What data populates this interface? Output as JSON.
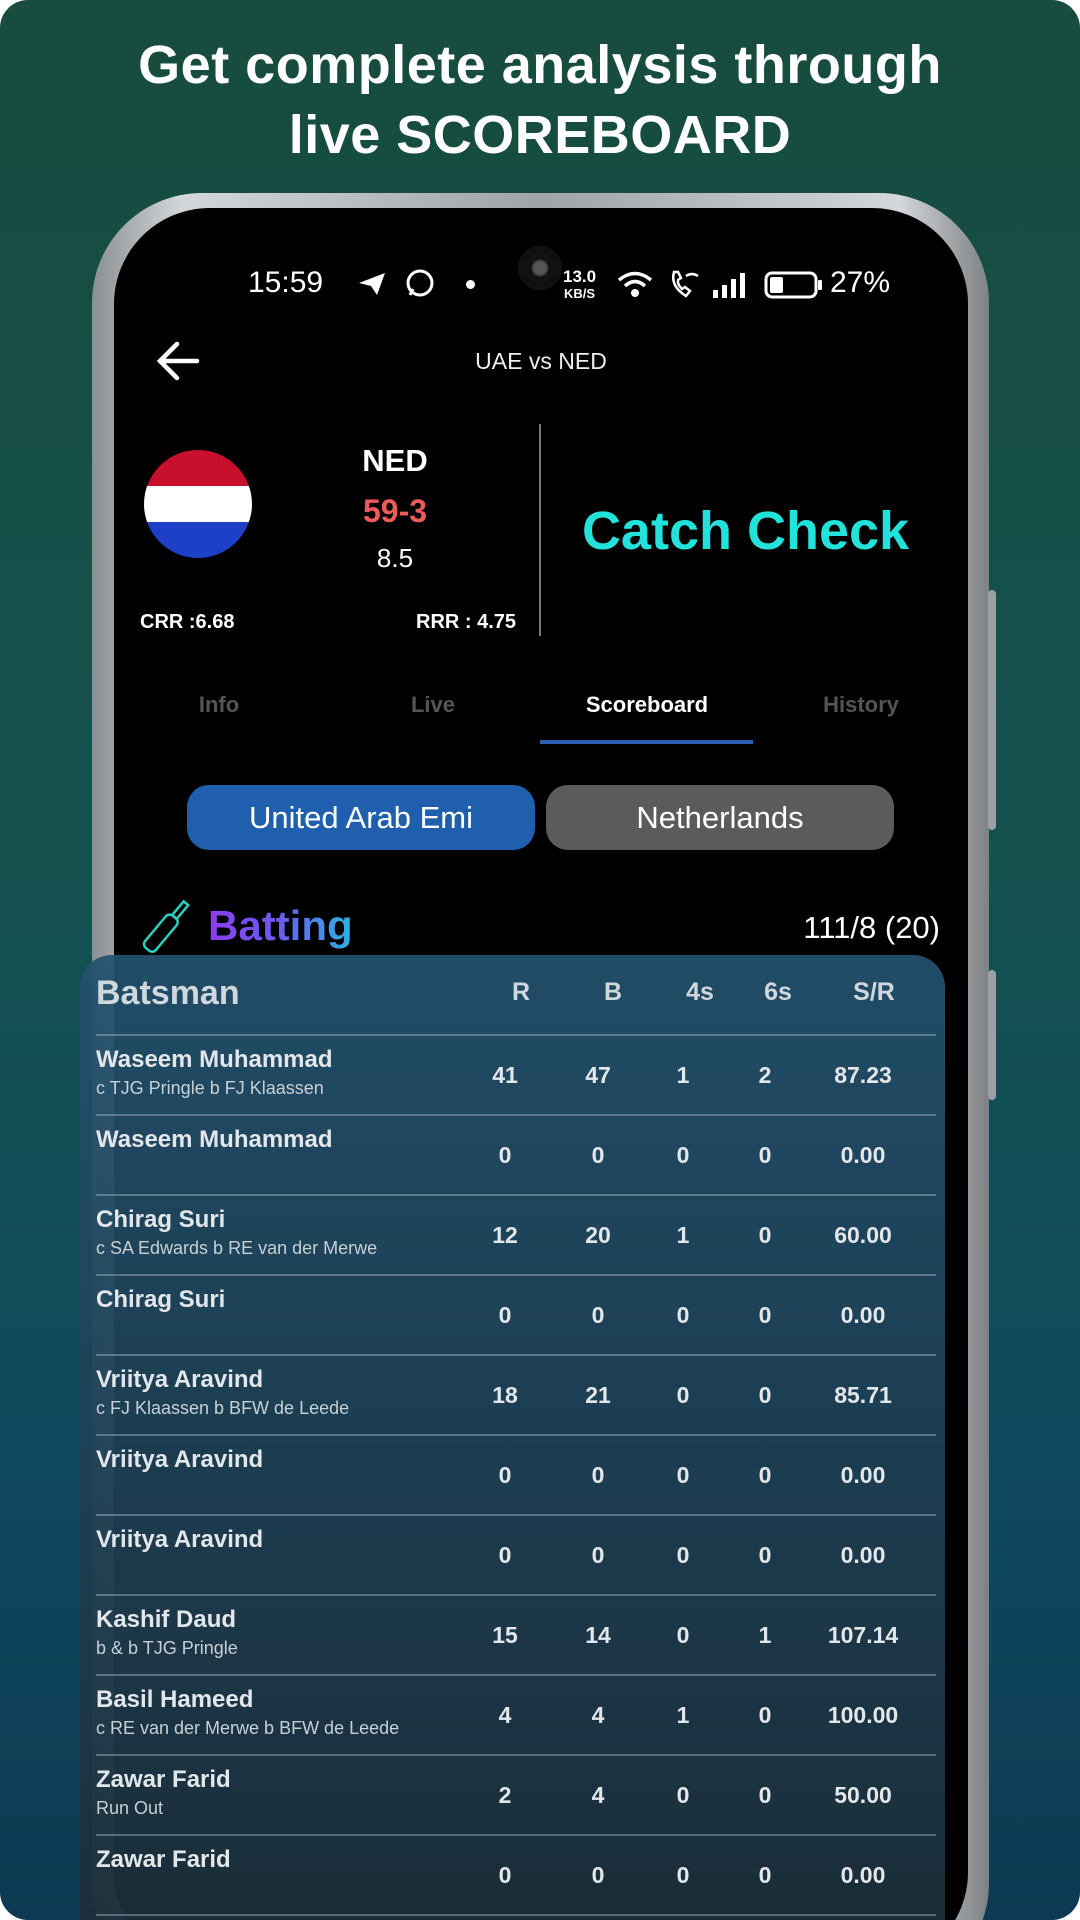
{
  "headline": {
    "line1": "Get complete analysis through",
    "line2": "live SCOREBOARD"
  },
  "status_bar": {
    "time": "15:59",
    "net_speed_value": "13.0",
    "net_speed_unit": "KB/S",
    "battery": "27%"
  },
  "header": {
    "title": "UAE vs NED"
  },
  "match": {
    "team": "NED",
    "score": "59-3",
    "overs": "8.5",
    "crr": "CRR :6.68",
    "rrr": "RRR : 4.75",
    "banner": "Catch Check",
    "flag_colors": [
      "#c8102e",
      "#ffffff",
      "#1e40c8"
    ]
  },
  "tabs": [
    {
      "label": "Info"
    },
    {
      "label": "Live"
    },
    {
      "label": "Scoreboard",
      "active": true
    },
    {
      "label": "History"
    }
  ],
  "teams": [
    {
      "label": "United Arab Emi",
      "selected": true
    },
    {
      "label": "Netherlands"
    }
  ],
  "batting": {
    "title": "Batting",
    "total": "111/8 (20)"
  },
  "table": {
    "headers": [
      "Batsman",
      "R",
      "B",
      "4s",
      "6s",
      "S/R"
    ],
    "rows": [
      {
        "name": "Waseem Muhammad",
        "dismissal": "c TJG Pringle b FJ Klaassen",
        "r": "41",
        "b": "47",
        "fours": "1",
        "sixes": "2",
        "sr": "87.23"
      },
      {
        "name": "Waseem Muhammad",
        "dismissal": "",
        "r": "0",
        "b": "0",
        "fours": "0",
        "sixes": "0",
        "sr": "0.00"
      },
      {
        "name": "Chirag Suri",
        "dismissal": "c SA Edwards b RE van der Merwe",
        "r": "12",
        "b": "20",
        "fours": "1",
        "sixes": "0",
        "sr": "60.00"
      },
      {
        "name": "Chirag Suri",
        "dismissal": "",
        "r": "0",
        "b": "0",
        "fours": "0",
        "sixes": "0",
        "sr": "0.00"
      },
      {
        "name": "Vriitya Aravind",
        "dismissal": "c FJ Klaassen b BFW de Leede",
        "r": "18",
        "b": "21",
        "fours": "0",
        "sixes": "0",
        "sr": "85.71"
      },
      {
        "name": "Vriitya Aravind",
        "dismissal": "",
        "r": "0",
        "b": "0",
        "fours": "0",
        "sixes": "0",
        "sr": "0.00"
      },
      {
        "name": "Vriitya Aravind",
        "dismissal": "",
        "r": "0",
        "b": "0",
        "fours": "0",
        "sixes": "0",
        "sr": "0.00"
      },
      {
        "name": "Kashif Daud",
        "dismissal": "b & b TJG Pringle",
        "r": "15",
        "b": "14",
        "fours": "0",
        "sixes": "1",
        "sr": "107.14"
      },
      {
        "name": "Basil Hameed",
        "dismissal": "c RE van der Merwe b BFW de Leede",
        "r": "4",
        "b": "4",
        "fours": "1",
        "sixes": "0",
        "sr": "100.00"
      },
      {
        "name": "Zawar Farid",
        "dismissal": "Run Out",
        "r": "2",
        "b": "4",
        "fours": "0",
        "sixes": "0",
        "sr": "50.00"
      },
      {
        "name": "Zawar Farid",
        "dismissal": "",
        "r": "0",
        "b": "0",
        "fours": "0",
        "sixes": "0",
        "sr": "0.00"
      }
    ]
  },
  "colors": {
    "accent_blue": "#1f5fae",
    "banner_cyan": "#22e3dc",
    "score_red": "#f05a5a",
    "tab_underline": "#2d5fb0"
  }
}
